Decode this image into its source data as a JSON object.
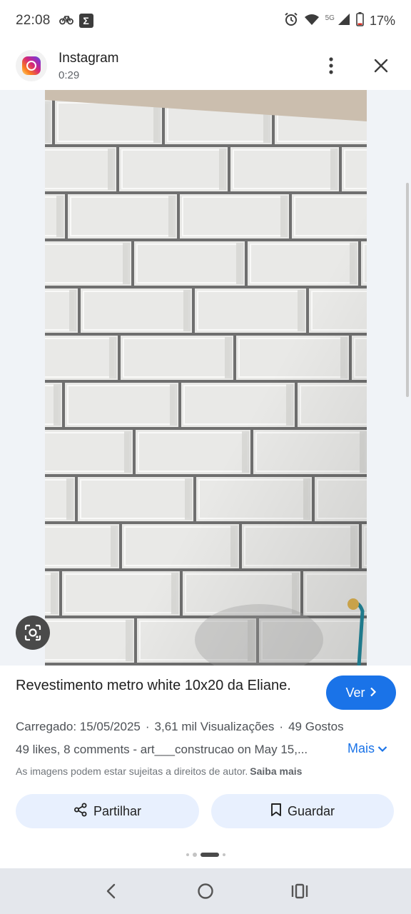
{
  "status_bar": {
    "time": "22:08",
    "network_label": "5G",
    "battery": "17%",
    "icons": [
      "bike-icon",
      "sigma-icon",
      "alarm-icon",
      "wifi-icon",
      "signal-icon",
      "battery-icon"
    ]
  },
  "header": {
    "app_name": "Instagram",
    "duration": "0:29",
    "icons": [
      "instagram-logo",
      "more-vert-icon",
      "close-icon"
    ]
  },
  "image": {
    "subject": "white beveled subway tile wall",
    "colors": {
      "tile": "#e9e9e7",
      "grout": "#6f6f6f",
      "ceiling": "#cbbeae",
      "backdrop": "#f0f3f7"
    }
  },
  "lens": {
    "icon": "google-lens-icon"
  },
  "result": {
    "title": "Revestimento metro white 10x20 da Eliane.",
    "view_button": "Ver",
    "uploaded": "Carregado: 15/05/2025",
    "views": "3,61 mil Visualizações",
    "likes": "49 Gostos",
    "description": "49 likes, 8 comments - art___construcao on May 15,...",
    "more": "Mais",
    "copyright_notice": "As imagens podem estar sujeitas a direitos de autor.",
    "learn_more": "Saiba mais",
    "share": "Partilhar",
    "save": "Guardar"
  },
  "colors": {
    "accent": "#1a73e8",
    "pill_bg": "#e8f0fe",
    "nav_bg": "#e4e7ec"
  },
  "nav": {
    "icons": [
      "back-icon",
      "home-icon",
      "recents-icon"
    ]
  }
}
